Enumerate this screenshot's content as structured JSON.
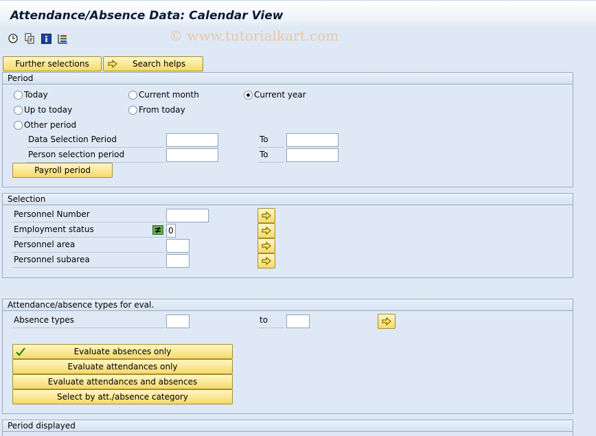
{
  "window": {
    "title": "Attendance/Absence Data: Calendar View",
    "watermark": "© www.tutorialkart.com"
  },
  "toolbar": {
    "icons": [
      "execute-icon",
      "variant-icon",
      "info-icon",
      "grid-icon"
    ]
  },
  "top_buttons": {
    "further_selections": "Further selections",
    "search_helps": "Search helps"
  },
  "period": {
    "header": "Period",
    "radios": {
      "today": "Today",
      "current_month": "Current month",
      "current_year": "Current year",
      "up_to_today": "Up to today",
      "from_today": "From today",
      "other_period": "Other period"
    },
    "selected": "current_year",
    "data_selection_label": "Data Selection Period",
    "person_selection_label": "Person selection period",
    "to_label": "To",
    "data_from": "",
    "data_to": "",
    "person_from": "",
    "person_to": "",
    "payroll_button": "Payroll period"
  },
  "selection": {
    "header": "Selection",
    "personnel_number": "Personnel Number",
    "employment_status": "Employment status",
    "employment_status_value": "0",
    "personnel_area": "Personnel area",
    "personnel_subarea": "Personnel subarea"
  },
  "types": {
    "header": "Attendance/absence types for eval.",
    "absence_types": "Absence types",
    "to_label": "to",
    "buttons": {
      "absences_only": "Evaluate absences only",
      "attendances_only": "Evaluate attendances only",
      "both": "Evaluate attendances and absences",
      "category": "Select by att./absence category"
    }
  },
  "period_displayed": {
    "header": "Period displayed"
  },
  "colors": {
    "background": "#dfe9f5",
    "button_fill": "#f5da6b",
    "group_border": "#97abc4"
  }
}
